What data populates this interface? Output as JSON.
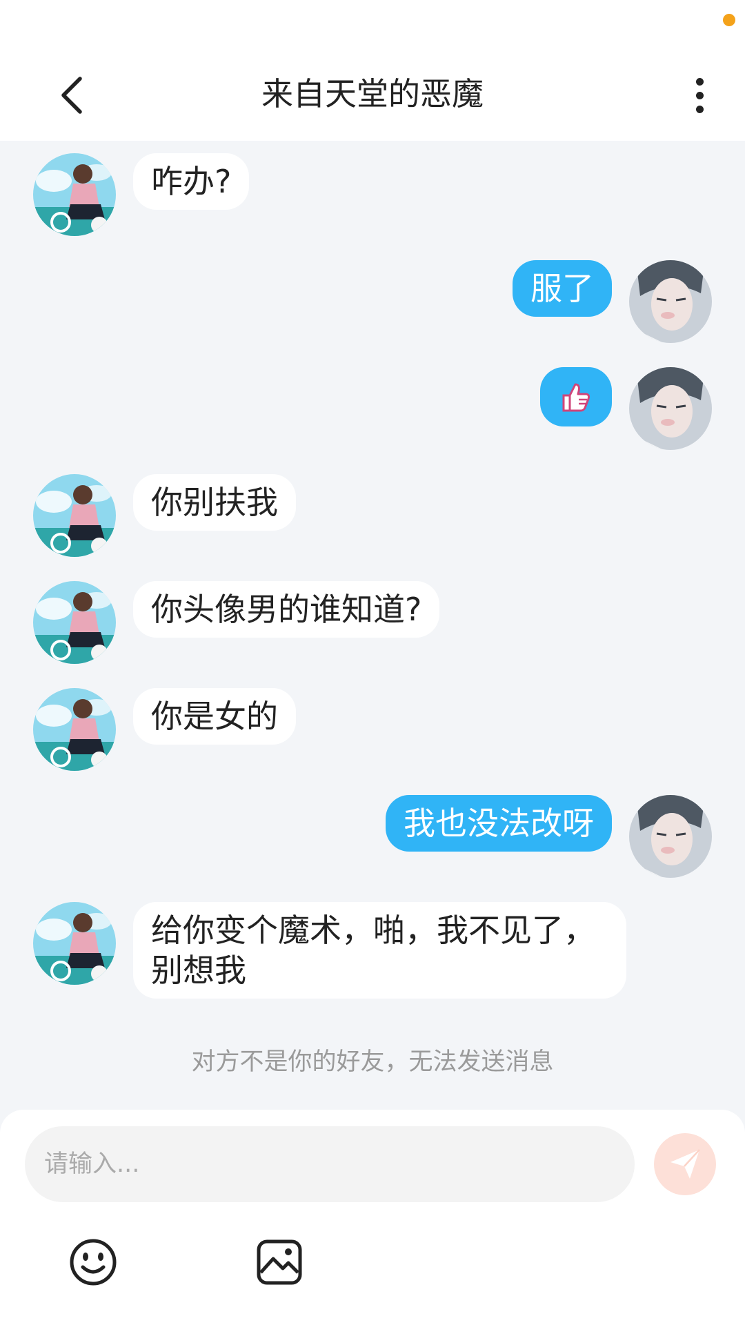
{
  "header": {
    "title": "来自天堂的恶魔",
    "back_icon": "chevron-left-icon",
    "more_icon": "more-vertical-icon"
  },
  "messages": [
    {
      "side": "left",
      "text": "咋办?"
    },
    {
      "side": "right",
      "text": "服了"
    },
    {
      "side": "right",
      "text": "",
      "sticker": "thumbs-up-icon"
    },
    {
      "side": "left",
      "text": "你别扶我"
    },
    {
      "side": "left",
      "text": "你头像男的谁知道?"
    },
    {
      "side": "left",
      "text": "你是女的"
    },
    {
      "side": "right",
      "text": "我也没法改呀"
    },
    {
      "side": "left",
      "text": "给你变个魔术，啪，我不见了，\n别想我"
    }
  ],
  "notice": "对方不是你的好友，无法发送消息",
  "composer": {
    "placeholder": "请输入...",
    "send_icon": "paper-plane-icon",
    "emoji_icon": "smiley-icon",
    "image_icon": "image-icon"
  },
  "colors": {
    "accent": "#30b4f6",
    "background": "#f3f5f8",
    "status_dot": "#f4a21a",
    "send_disabled": "#fde0d8"
  }
}
